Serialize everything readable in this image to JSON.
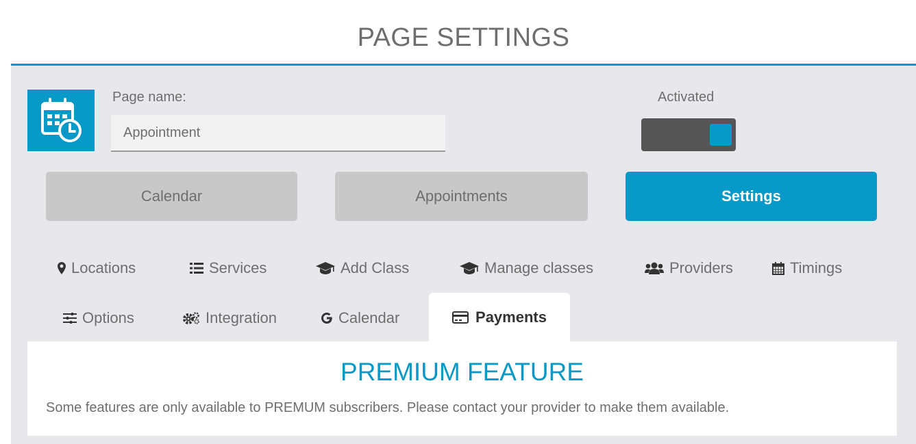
{
  "header": {
    "title": "PAGE SETTINGS"
  },
  "page": {
    "icon": "calendar-clock-icon",
    "name_label": "Page name:",
    "name_value": "Appointment",
    "activated_label": "Activated",
    "activated": true
  },
  "nav": {
    "calendar": "Calendar",
    "appointments": "Appointments",
    "settings": "Settings",
    "active": "Settings"
  },
  "tabs": {
    "locations": {
      "label": "Locations",
      "icon": "map-marker-icon"
    },
    "services": {
      "label": "Services",
      "icon": "list-icon"
    },
    "add_class": {
      "label": "Add Class",
      "icon": "graduation-cap-icon"
    },
    "manage_classes": {
      "label": "Manage classes",
      "icon": "graduation-cap-icon"
    },
    "providers": {
      "label": "Providers",
      "icon": "users-icon"
    },
    "timings": {
      "label": "Timings",
      "icon": "calendar-icon"
    },
    "options": {
      "label": "Options",
      "icon": "sliders-icon"
    },
    "integration": {
      "label": "Integration",
      "icon": "cogs-icon"
    },
    "google_calendar": {
      "label": "Calendar",
      "icon": "google-icon"
    },
    "payments": {
      "label": "Payments",
      "icon": "credit-card-icon"
    },
    "active": "Payments"
  },
  "panel": {
    "title": "PREMIUM FEATURE",
    "text": "Some features are only available to PREMUM subscribers. Please contact your provider to make them available."
  },
  "colors": {
    "accent": "#0799c7",
    "toggle_track": "#555555",
    "button_inactive": "#c8c8c8",
    "background": "#e8e8ec"
  }
}
